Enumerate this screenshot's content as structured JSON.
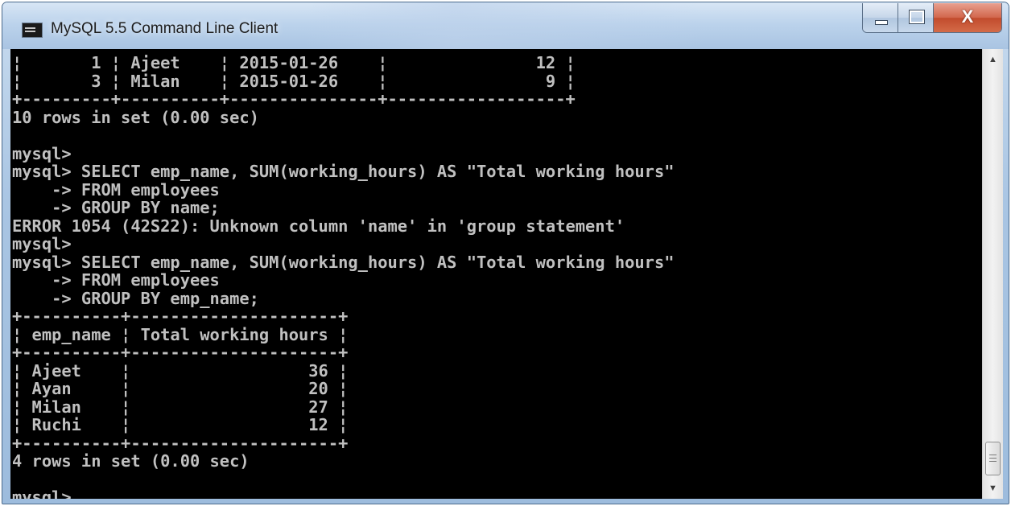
{
  "window": {
    "title": "MySQL 5.5 Command Line Client",
    "close_glyph": "X"
  },
  "icons": {
    "app": "mysql-console-icon",
    "minimize": "minimize-icon",
    "maximize": "maximize-icon",
    "close": "close-icon",
    "scroll_up": "scroll-up-arrow-icon",
    "scroll_down": "scroll-down-arrow-icon",
    "scroll_thumb_grip": "grip-icon"
  },
  "colors": {
    "console_background": "#000000",
    "console_text": "#c0c0c0",
    "close_button": "#c7502f"
  },
  "console": {
    "lines": [
      "¦       1 ¦ Ajeet    ¦ 2015-01-26    ¦               12 ¦",
      "¦       3 ¦ Milan    ¦ 2015-01-26    ¦                9 ¦",
      "+---------+----------+---------------+------------------+",
      "10 rows in set (0.00 sec)",
      "",
      "mysql>",
      "mysql> SELECT emp_name, SUM(working_hours) AS \"Total working hours\"",
      "    -> FROM employees",
      "    -> GROUP BY name;",
      "ERROR 1054 (42S22): Unknown column 'name' in 'group statement'",
      "mysql>",
      "mysql> SELECT emp_name, SUM(working_hours) AS \"Total working hours\"",
      "    -> FROM employees",
      "    -> GROUP BY emp_name;",
      "+----------+---------------------+",
      "¦ emp_name ¦ Total working hours ¦",
      "+----------+---------------------+",
      "¦ Ajeet    ¦                  36 ¦",
      "¦ Ayan     ¦                  20 ¦",
      "¦ Milan    ¦                  27 ¦",
      "¦ Ruchi    ¦                  12 ¦",
      "+----------+---------------------+",
      "4 rows in set (0.00 sec)",
      "",
      "mysql> _"
    ]
  },
  "scrollbar": {
    "up_arrow": "▲",
    "down_arrow": "▼"
  }
}
